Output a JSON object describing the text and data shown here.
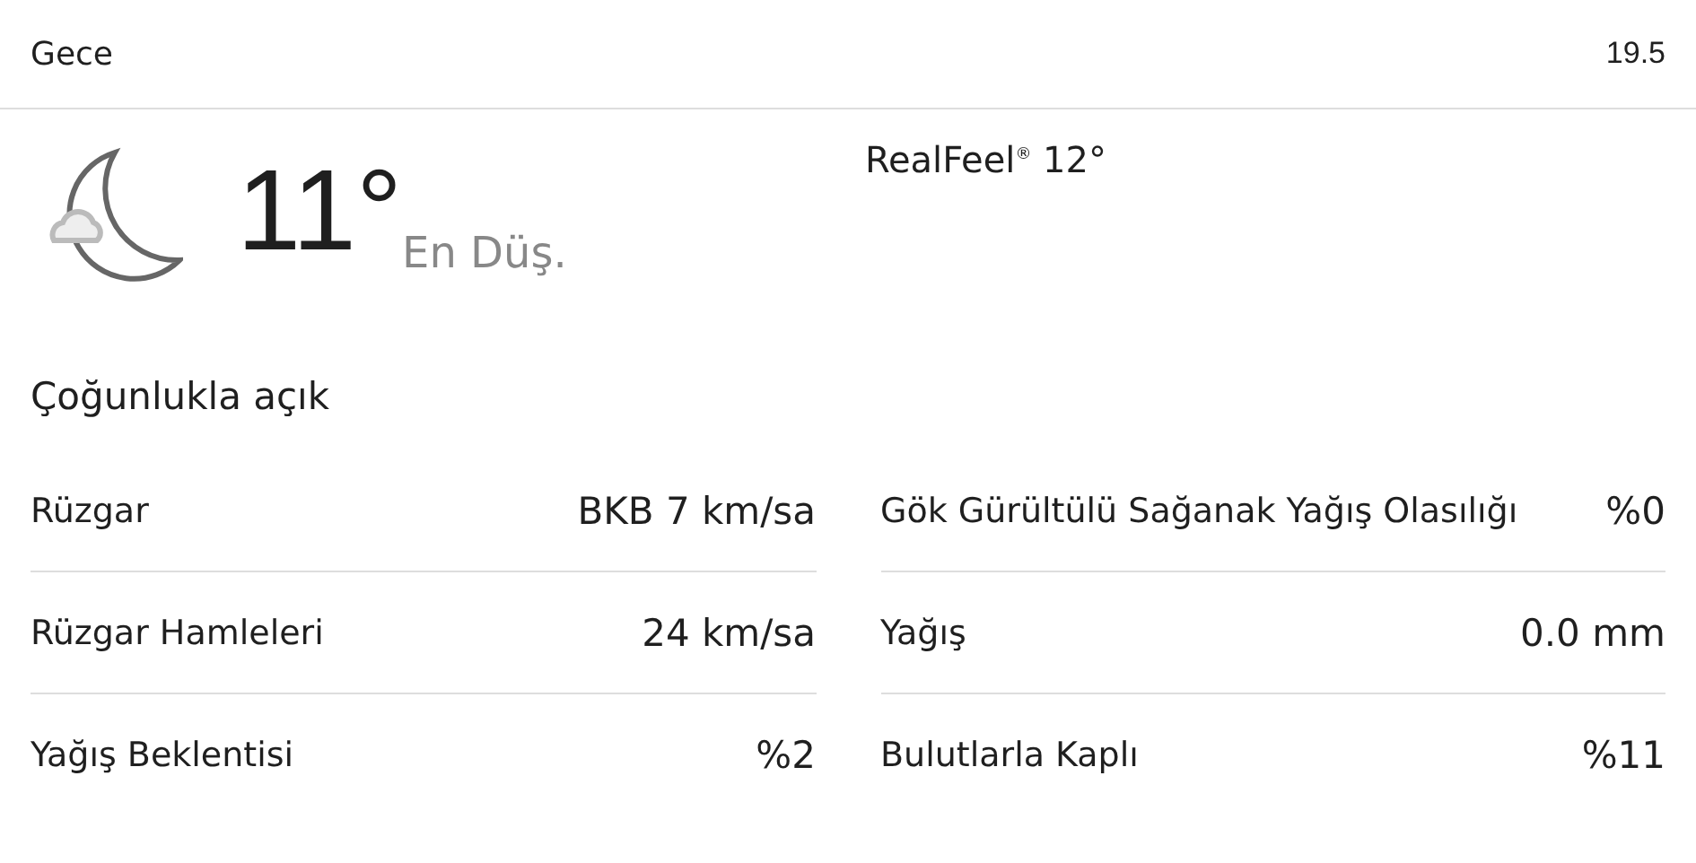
{
  "header": {
    "title": "Gece",
    "date": "19.5"
  },
  "temperature": {
    "value": "11°",
    "label": "En Düş."
  },
  "realfeel": "RealFeel$^{®}$ 12°",
  "condition": "Çoğunlukla açık",
  "details": [
    [
      {
        "label": "Rüzgar",
        "value": "BKB 7 km/sa"
      },
      {
        "label": "Rüzgar Hamleleri",
        "value": "24 km/sa"
      },
      {
        "label": "Yağış Beklentisi",
        "value": "%2"
      }
    ],
    [
      {
        "label": "Gök Gürültülü Sağanak Yağış Olasılığı",
        "value": "%0"
      },
      {
        "label": "Yağış",
        "value": "0.0 mm"
      },
      {
        "label": "Bulutlarla Kaplı",
        "value": "%11"
      }
    ]
  ]
}
